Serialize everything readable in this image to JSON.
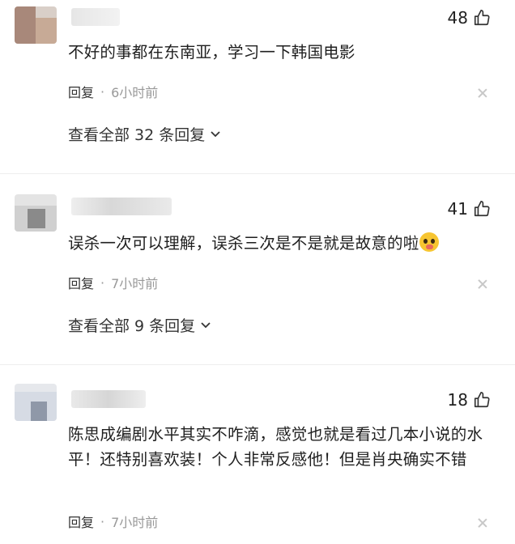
{
  "comments": [
    {
      "likes": "48",
      "text": "不好的事都在东南亚，学习一下韩国电影",
      "reply_label": "回复",
      "separator": "·",
      "time": "6小时前",
      "view_all": "查看全部 32 条回复"
    },
    {
      "likes": "41",
      "text": "误杀一次可以理解，误杀三次是不是就是故意的啦",
      "emoji": "face-with-hand-over-mouth",
      "reply_label": "回复",
      "separator": "·",
      "time": "7小时前",
      "view_all": "查看全部 9 条回复"
    },
    {
      "likes": "18",
      "text": "陈思成编剧水平其实不咋滴，感觉也就是看过几本小说的水平！还特别喜欢装！个人非常反感他！但是肖央确实不错",
      "reply_label": "回复",
      "separator": "·",
      "time": "7小时前"
    }
  ],
  "icons": {
    "like": "thumbs-up-icon",
    "close": "close-icon",
    "expand": "chevron-down-icon"
  },
  "colors": {
    "text": "#1f1f1f",
    "muted": "#999999",
    "divider": "#eeeeee"
  }
}
